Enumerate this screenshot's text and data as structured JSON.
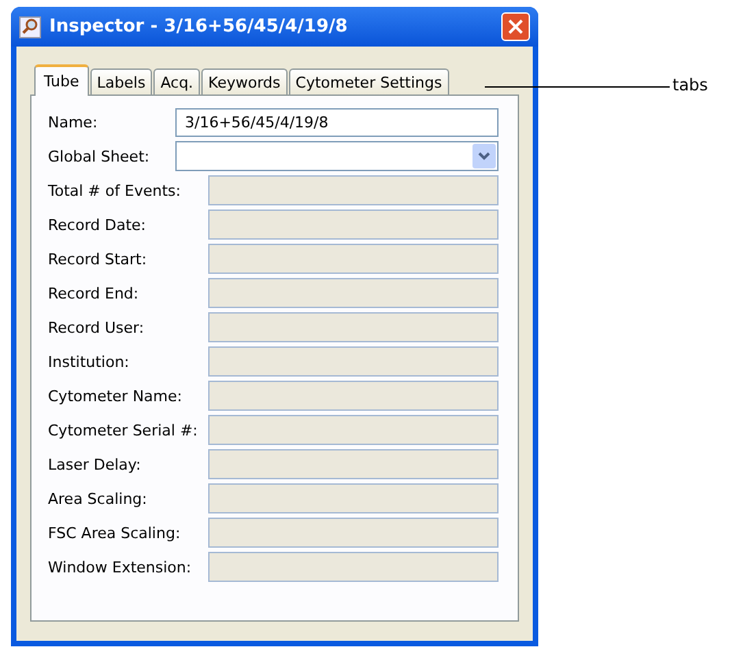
{
  "window": {
    "title": "Inspector - 3/16+56/45/4/19/8"
  },
  "tabs": [
    {
      "label": "Tube",
      "selected": true
    },
    {
      "label": "Labels",
      "selected": false
    },
    {
      "label": "Acq.",
      "selected": false
    },
    {
      "label": "Keywords",
      "selected": false
    },
    {
      "label": "Cytometer Settings",
      "selected": false
    }
  ],
  "fields": [
    {
      "kind": "text",
      "label": "Name:",
      "value": "3/16+56/45/4/19/8"
    },
    {
      "kind": "dropdown",
      "label": "Global Sheet:"
    },
    {
      "kind": "readonly",
      "label": "Total # of Events:"
    },
    {
      "kind": "readonly",
      "label": "Record Date:"
    },
    {
      "kind": "readonly",
      "label": "Record Start:"
    },
    {
      "kind": "readonly",
      "label": "Record End:"
    },
    {
      "kind": "readonly",
      "label": "Record User:"
    },
    {
      "kind": "readonly",
      "label": "Institution:"
    },
    {
      "kind": "readonly",
      "label": "Cytometer Name:"
    },
    {
      "kind": "readonly",
      "label": "Cytometer Serial #:"
    },
    {
      "kind": "readonly",
      "label": "Laser Delay:"
    },
    {
      "kind": "readonly",
      "label": "Area Scaling:"
    },
    {
      "kind": "readonly",
      "label": "FSC Area Scaling:"
    },
    {
      "kind": "readonly",
      "label": "Window Extension:"
    }
  ],
  "callout": {
    "label": "tabs"
  }
}
